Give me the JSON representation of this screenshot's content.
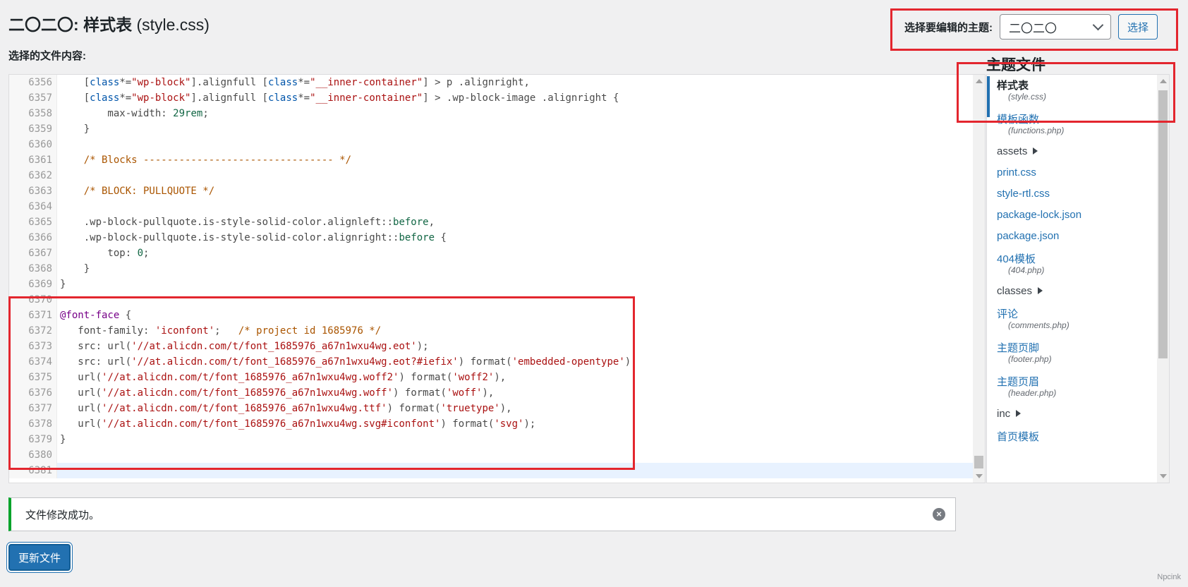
{
  "header": {
    "title_prefix": "二〇二〇:",
    "title_main": "样式表",
    "title_file": "(style.css)",
    "file_content_label": "选择的文件内容:"
  },
  "theme_picker": {
    "label": "选择要编辑的主题:",
    "selected": "二〇二〇",
    "button": "选择"
  },
  "editor": {
    "lines": [
      {
        "n": "6356",
        "html": "    [<span class='tok-blue'>class</span>*=<span class='tok-str'>\"wp-block\"</span>].alignfull [<span class='tok-blue'>class</span>*=<span class='tok-str'>\"__inner-container\"</span>] &gt; p .alignright,"
      },
      {
        "n": "6357",
        "html": "    [<span class='tok-blue'>class</span>*=<span class='tok-str'>\"wp-block\"</span>].alignfull [<span class='tok-blue'>class</span>*=<span class='tok-str'>\"__inner-container\"</span>] &gt; .wp-block-image .alignright {"
      },
      {
        "n": "6358",
        "html": "        max-width: <span class='tok-num'>29rem</span>;"
      },
      {
        "n": "6359",
        "html": "    }"
      },
      {
        "n": "6360",
        "html": ""
      },
      {
        "n": "6361",
        "html": "    <span class='tok-cmt'>/* Blocks -------------------------------- */</span>"
      },
      {
        "n": "6362",
        "html": ""
      },
      {
        "n": "6363",
        "html": "    <span class='tok-cmt'>/* BLOCK: PULLQUOTE */</span>"
      },
      {
        "n": "6364",
        "html": ""
      },
      {
        "n": "6365",
        "html": "    .wp-block-pullquote.is-style-solid-color.alignleft::<span class='tok-num'>before</span>,"
      },
      {
        "n": "6366",
        "html": "    .wp-block-pullquote.is-style-solid-color.alignright::<span class='tok-num'>before</span> {"
      },
      {
        "n": "6367",
        "html": "        top: <span class='tok-num'>0</span>;"
      },
      {
        "n": "6368",
        "html": "    }"
      },
      {
        "n": "6369",
        "html": "}"
      },
      {
        "n": "6370",
        "html": ""
      },
      {
        "n": "6371",
        "html": "<span class='tok-kw'>@font-face</span> {"
      },
      {
        "n": "6372",
        "html": "   font-family: <span class='tok-str'>'iconfont'</span>;   <span class='tok-cmt'>/* project id 1685976 */</span>"
      },
      {
        "n": "6373",
        "html": "   src: url(<span class='tok-str'>'//at.alicdn.com/t/font_1685976_a67n1wxu4wg.eot'</span>);"
      },
      {
        "n": "6374",
        "html": "   src: url(<span class='tok-str'>'//at.alicdn.com/t/font_1685976_a67n1wxu4wg.eot?#iefix'</span>) format(<span class='tok-str'>'embedded-opentype'</span>),"
      },
      {
        "n": "6375",
        "html": "   url(<span class='tok-str'>'//at.alicdn.com/t/font_1685976_a67n1wxu4wg.woff2'</span>) format(<span class='tok-str'>'woff2'</span>),"
      },
      {
        "n": "6376",
        "html": "   url(<span class='tok-str'>'//at.alicdn.com/t/font_1685976_a67n1wxu4wg.woff'</span>) format(<span class='tok-str'>'woff'</span>),"
      },
      {
        "n": "6377",
        "html": "   url(<span class='tok-str'>'//at.alicdn.com/t/font_1685976_a67n1wxu4wg.ttf'</span>) format(<span class='tok-str'>'truetype'</span>),"
      },
      {
        "n": "6378",
        "html": "   url(<span class='tok-str'>'//at.alicdn.com/t/font_1685976_a67n1wxu4wg.svg#iconfont'</span>) format(<span class='tok-str'>'svg'</span>);"
      },
      {
        "n": "6379",
        "html": "}"
      },
      {
        "n": "6380",
        "html": ""
      },
      {
        "n": "6381",
        "html": "",
        "active": true
      }
    ]
  },
  "theme_files": {
    "title": "主题文件",
    "items": [
      {
        "label": "样式表",
        "sub": "(style.css)",
        "type": "file",
        "active": true
      },
      {
        "label": "模板函数",
        "sub": "(functions.php)",
        "type": "file"
      },
      {
        "label": "assets",
        "type": "dir"
      },
      {
        "label": "print.css",
        "type": "file"
      },
      {
        "label": "style-rtl.css",
        "type": "file"
      },
      {
        "label": "package-lock.json",
        "type": "file"
      },
      {
        "label": "package.json",
        "type": "file"
      },
      {
        "label": "404模板",
        "sub": "(404.php)",
        "type": "file"
      },
      {
        "label": "classes",
        "type": "dir"
      },
      {
        "label": "评论",
        "sub": "(comments.php)",
        "type": "file"
      },
      {
        "label": "主题页脚",
        "sub": "(footer.php)",
        "type": "file"
      },
      {
        "label": "主题页眉",
        "sub": "(header.php)",
        "type": "file"
      },
      {
        "label": "inc",
        "type": "dir"
      },
      {
        "label": "首页模板",
        "type": "file"
      }
    ]
  },
  "notice": {
    "text": "文件修改成功。"
  },
  "update_button": "更新文件",
  "watermark": "Npcink",
  "colors": {
    "highlight_box": "#e3262e",
    "accent": "#2271b1",
    "success": "#00a32a"
  }
}
